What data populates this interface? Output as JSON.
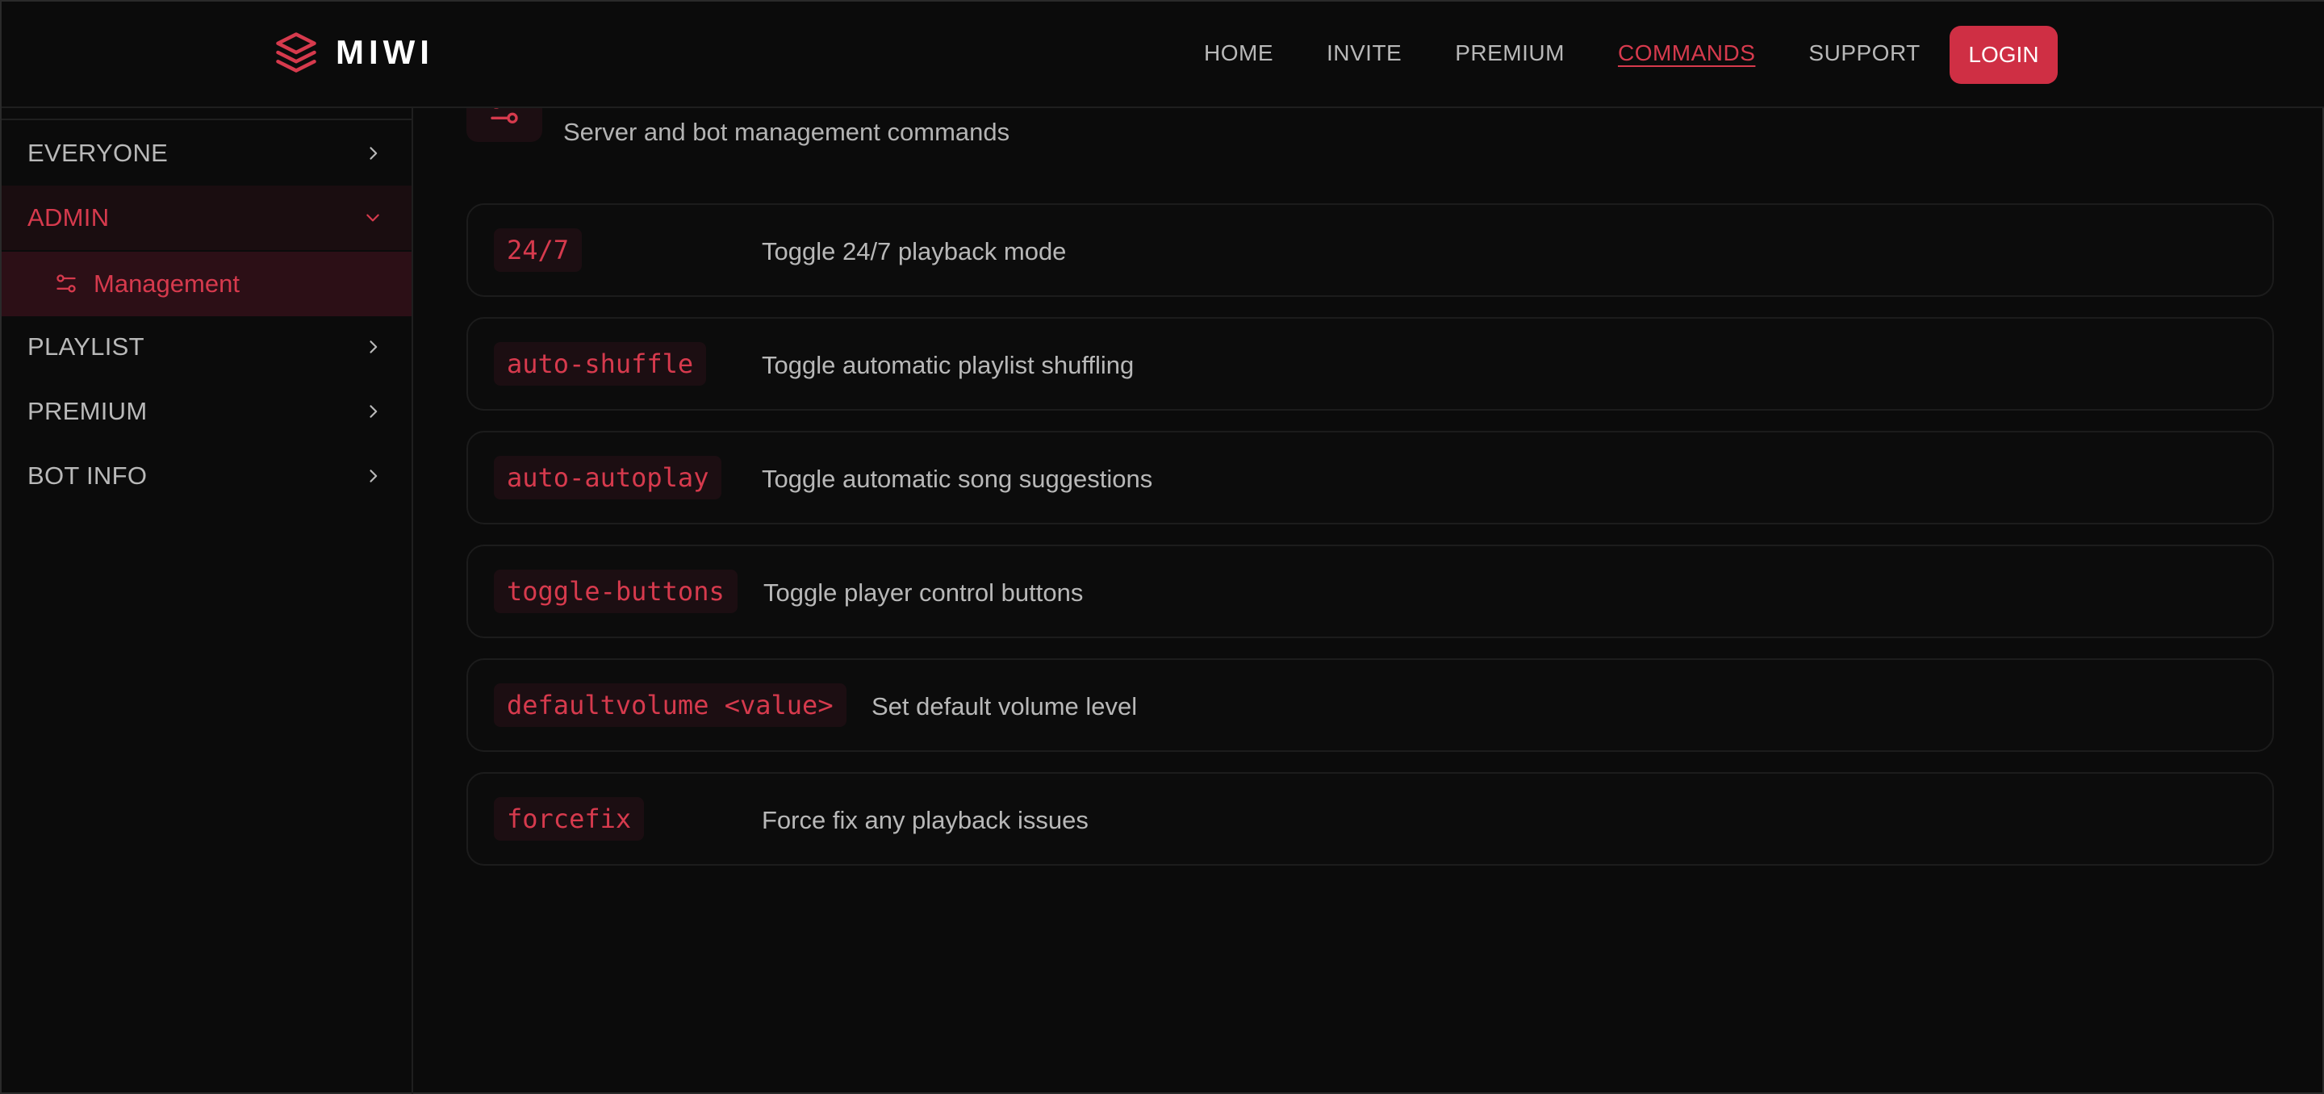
{
  "brand": {
    "name": "MIWI",
    "icon": "layers-icon",
    "accent": "#d63a4d"
  },
  "nav": {
    "links": [
      {
        "label": "HOME",
        "active": false
      },
      {
        "label": "INVITE",
        "active": false
      },
      {
        "label": "PREMIUM",
        "active": false
      },
      {
        "label": "COMMANDS",
        "active": true
      },
      {
        "label": "SUPPORT",
        "active": false
      }
    ],
    "login_label": "LOGIN"
  },
  "sidebar": {
    "items": [
      {
        "label": "EVERYONE",
        "expanded": false
      },
      {
        "label": "ADMIN",
        "expanded": true
      },
      {
        "label": "PLAYLIST",
        "expanded": false
      },
      {
        "label": "PREMIUM",
        "expanded": false
      },
      {
        "label": "BOT INFO",
        "expanded": false
      }
    ],
    "sub_item": {
      "label": "Management",
      "icon": "sliders-icon",
      "active": true
    }
  },
  "section": {
    "icon": "sliders-icon",
    "description": "Server and bot management commands"
  },
  "commands": [
    {
      "name": "24/7",
      "description": "Toggle 24/7 playback mode"
    },
    {
      "name": "auto-shuffle",
      "description": "Toggle automatic playlist shuffling"
    },
    {
      "name": "auto-autoplay",
      "description": "Toggle automatic song suggestions"
    },
    {
      "name": "toggle-buttons",
      "description": "Toggle player control buttons"
    },
    {
      "name": "defaultvolume <value>",
      "description": "Set default volume level"
    },
    {
      "name": "forcefix",
      "description": "Force fix any playback issues"
    }
  ]
}
